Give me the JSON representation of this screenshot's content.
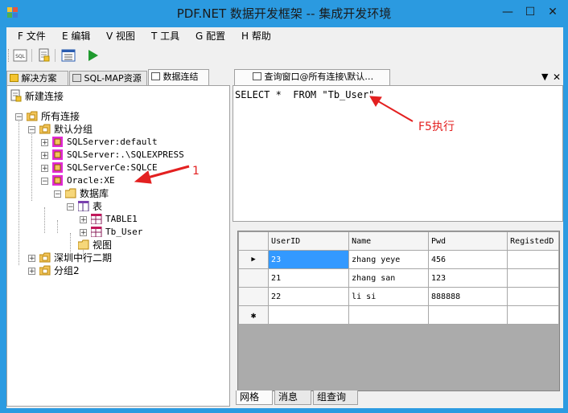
{
  "window": {
    "title": "PDF.NET 数据开发框架 -- 集成开发环境",
    "min_glyph": "—",
    "max_glyph": "☐",
    "close_glyph": "✕"
  },
  "menu": [
    "F 文件",
    "E 编辑",
    "V 视图",
    "T 工具",
    "G 配置",
    "H 帮助"
  ],
  "toolbar": {
    "items": [
      "sql-icon",
      "new-document-icon",
      "list-icon",
      "run-icon"
    ],
    "sql_text": "SQL"
  },
  "left_tabs": [
    "解决方案",
    "SQL-MAP资源",
    "数据连结"
  ],
  "left_active_tab": 2,
  "new_connection_label": "新建连接",
  "tree": {
    "root": "所有连接",
    "default_group": "默认分组",
    "connections": [
      "SQLServer:default",
      "SQLServer:.\\SQLEXPRESS",
      "SQLServerCe:SQLCE",
      "Oracle:XE"
    ],
    "database": "数据库",
    "tables_node": "表",
    "tables": [
      "TABLE1",
      "Tb_User"
    ],
    "views_node": "视图",
    "other_groups": [
      "深圳中行二期",
      "分组2"
    ]
  },
  "query_tab": {
    "title": "查询窗口@所有连接\\默认…",
    "dropdown_glyph": "▼",
    "close_glyph": "✕"
  },
  "query_text": "SELECT *  FROM \"Tb_User\"",
  "annotations": {
    "label_1": "1",
    "label_f5": "F5执行",
    "color": "#e32020"
  },
  "grid": {
    "columns": [
      "UserID",
      "Name",
      "Pwd",
      "RegistedD"
    ],
    "rows": [
      [
        "23",
        "zhang yeye",
        "456"
      ],
      [
        "21",
        "zhang san",
        "123"
      ],
      [
        "22",
        "li si",
        "888888"
      ]
    ],
    "current_row_glyph": "▶",
    "new_row_glyph": "✱"
  },
  "bottom_tabs": [
    "网格",
    "消息",
    "组查询"
  ],
  "colors": {
    "window_frame": "#2b9ae0",
    "selected_cell": "#3399ff",
    "grid_empty": "#ababab"
  }
}
